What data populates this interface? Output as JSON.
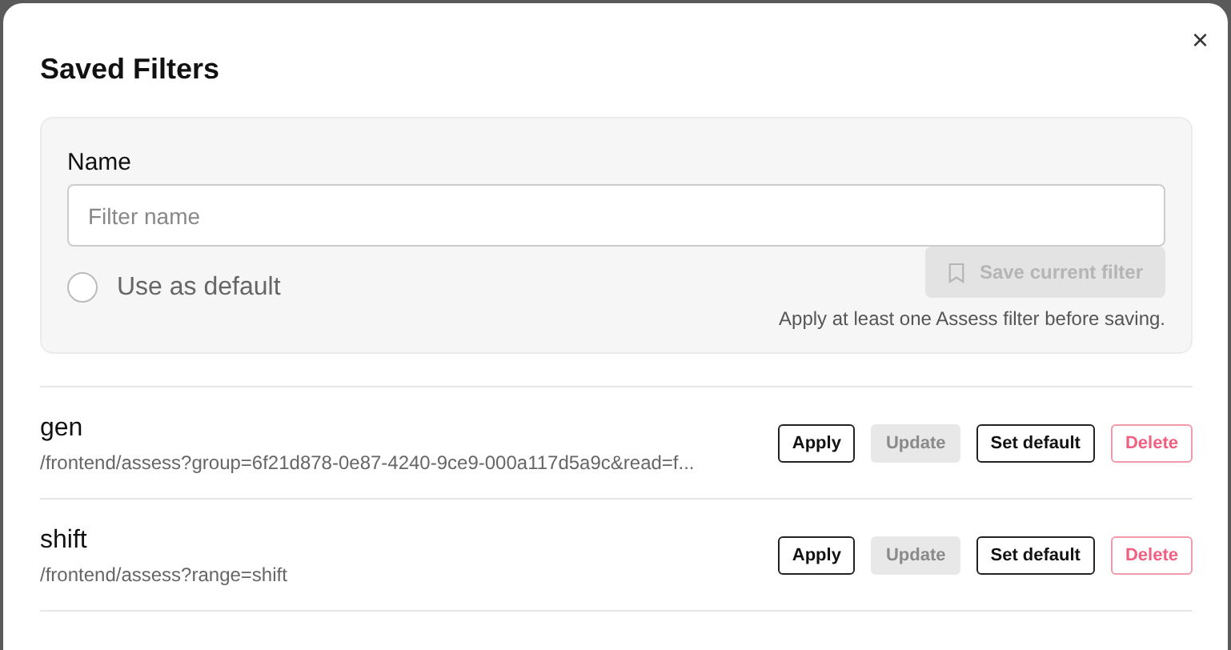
{
  "dialog": {
    "title": "Saved Filters",
    "close_label": "×"
  },
  "form": {
    "name_label": "Name",
    "name_field": {
      "placeholder": "Filter name"
    },
    "use_as_default": {
      "label": "Use as default",
      "checked": false
    },
    "save_button": {
      "label": "Save current filter",
      "disabled": true
    },
    "hint": "Apply at least one Assess filter before saving."
  },
  "filters": [
    {
      "name": "gen",
      "url": "/frontend/assess?group=6f21d878-0e87-4240-9ce9-000a117d5a9c&read=f...",
      "actions": [
        {
          "label": "Apply",
          "kind": "normal",
          "disabled": false
        },
        {
          "label": "Update",
          "kind": "normal",
          "disabled": true
        },
        {
          "label": "Set default",
          "kind": "normal",
          "disabled": false
        },
        {
          "label": "Delete",
          "kind": "danger",
          "disabled": false
        }
      ]
    },
    {
      "name": "shift",
      "url": "/frontend/assess?range=shift",
      "actions": [
        {
          "label": "Apply",
          "kind": "normal",
          "disabled": false
        },
        {
          "label": "Update",
          "kind": "normal",
          "disabled": true
        },
        {
          "label": "Set default",
          "kind": "normal",
          "disabled": false
        },
        {
          "label": "Delete",
          "kind": "danger",
          "disabled": false
        }
      ]
    }
  ]
}
